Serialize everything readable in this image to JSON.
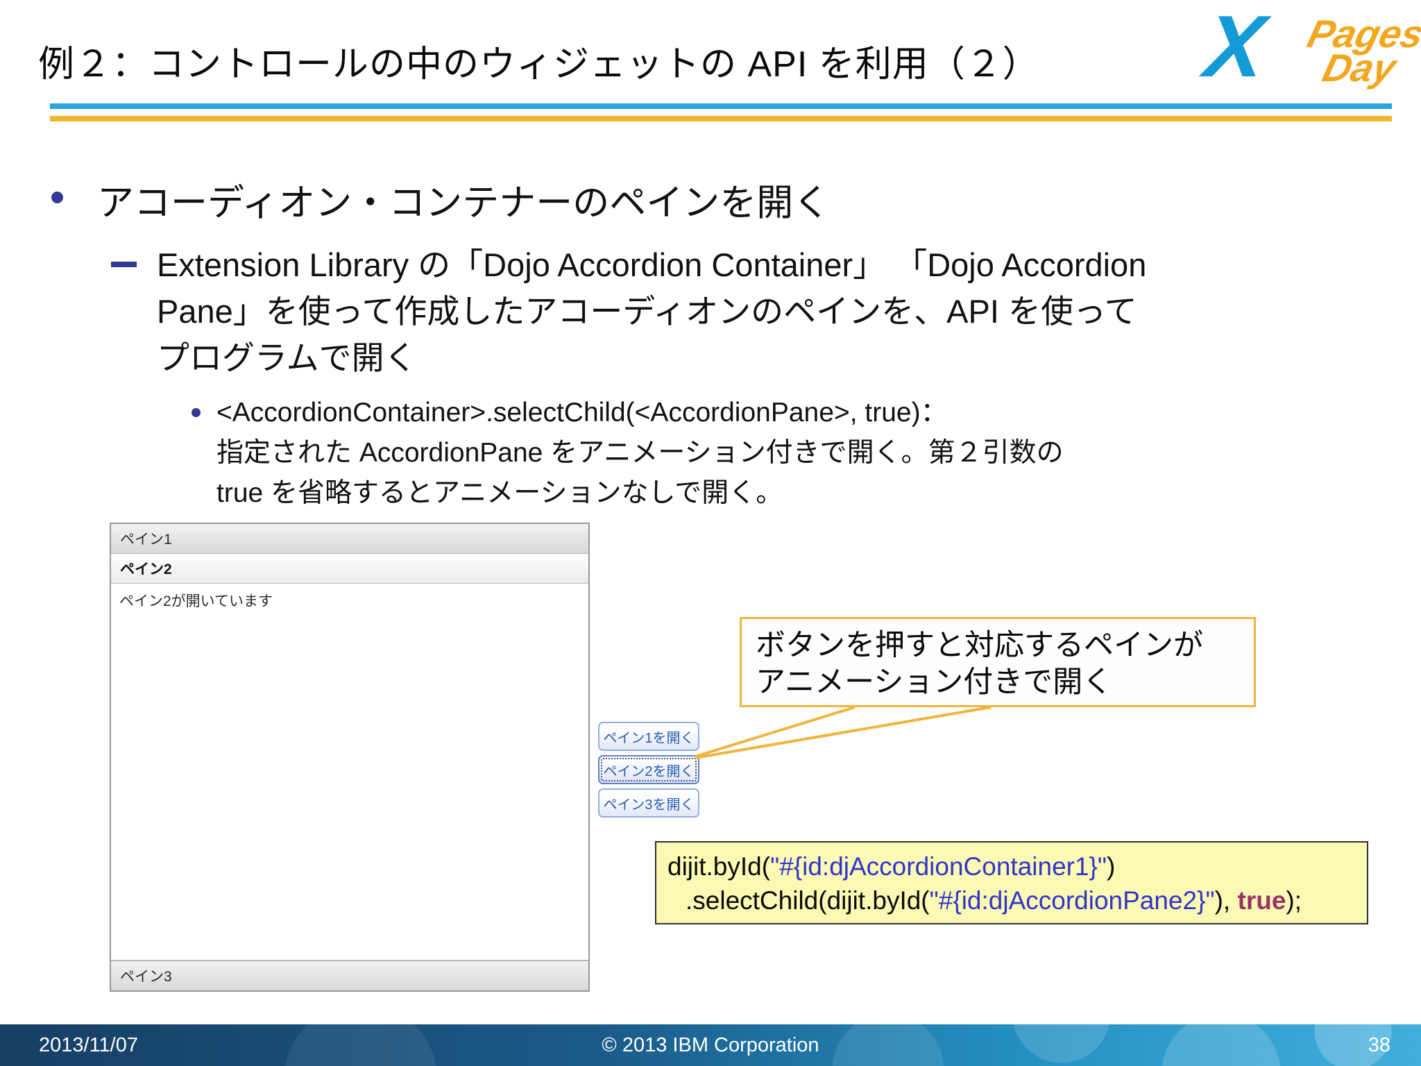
{
  "slide": {
    "title": "例２：コントロールの中のウィジェットの API を利用（２）",
    "date": "2013/11/07",
    "copyright": "© 2013 IBM Corporation",
    "page_number": "38"
  },
  "logo": {
    "x": "X",
    "word1": "Pages",
    "word2": "Day"
  },
  "bullets": {
    "level1": "アコーディオン・コンテナーのペインを開く",
    "level2_lines": [
      "Extension Library の「Dojo Accordion Container」 「Dojo Accordion",
      "Pane」を使って作成したアコーディオンのペインを、API を使って",
      "プログラムで開く"
    ],
    "level3_lines": [
      "<AccordionContainer>.selectChild(<AccordionPane>, true)：",
      "指定された AccordionPane をアニメーション付きで開く。第２引数の",
      "true を省略するとアニメーションなしで開く。"
    ]
  },
  "accordion": {
    "pane1_label": "ペイン1",
    "pane2_label": "ペイン2",
    "pane2_content": "ペイン2が開いています",
    "pane3_label": "ペイン3"
  },
  "buttons": {
    "open_pane1": "ペイン1を開く",
    "open_pane2": "ペイン2を開く",
    "open_pane3": "ペイン3を開く"
  },
  "callout": {
    "line1": "ボタンを押すと対応するペインが",
    "line2": "アニメーション付きで開く"
  },
  "code": {
    "line1": [
      {
        "t": "dijit.byId(",
        "c": "plain"
      },
      {
        "t": "\"#{id:djAccordionContainer1}\"",
        "c": "string"
      },
      {
        "t": ")",
        "c": "plain"
      }
    ],
    "line2": [
      {
        "t": ".selectChild(dijit.byId(",
        "c": "plain"
      },
      {
        "t": "\"#{id:djAccordionPane2}\"",
        "c": "string"
      },
      {
        "t": "), ",
        "c": "plain"
      },
      {
        "t": "true",
        "c": "bool"
      },
      {
        "t": ");",
        "c": "plain"
      }
    ]
  },
  "colors": {
    "accent_blue": "#29a4dc",
    "accent_yellow": "#eeb52f",
    "logo_blue": "#149bd7",
    "logo_orange": "#f2a71f",
    "bullet_navy": "#333a96",
    "callout_orange": "#f0b43c",
    "code_bg": "#fafab4",
    "code_string": "#3333cc",
    "code_bool": "#993366",
    "button_text": "#2a5bb0",
    "button_border": "#93aee0",
    "footer_left": "#173e63",
    "footer_right": "#41afdc"
  }
}
